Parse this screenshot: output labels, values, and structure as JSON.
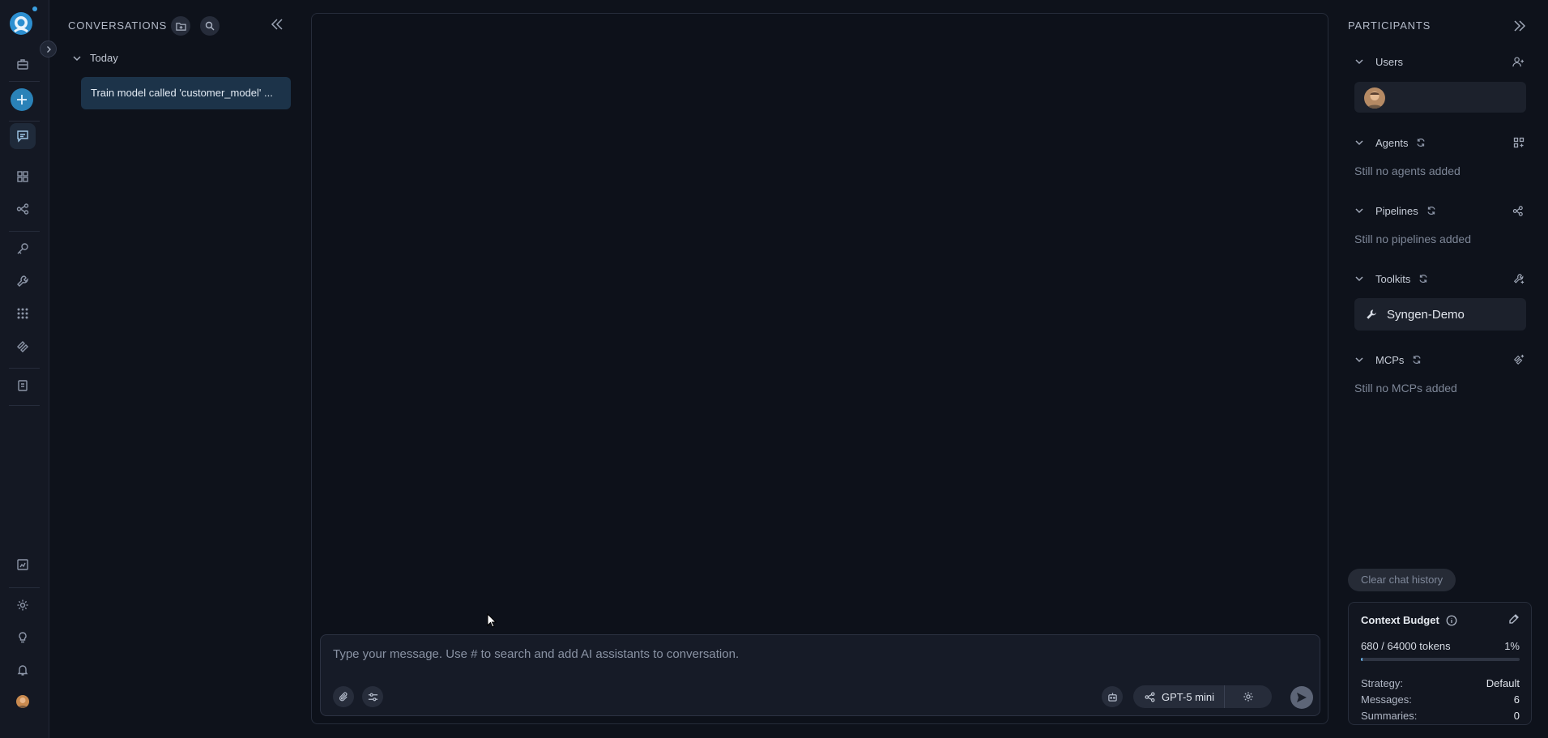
{
  "sidebar": {
    "items": [
      {
        "icon": "briefcase-icon"
      },
      {
        "icon": "plus-icon"
      },
      {
        "icon": "chat-icon",
        "active": true
      },
      {
        "icon": "grid-icon"
      },
      {
        "icon": "pipeline-icon"
      },
      {
        "icon": "key-icon"
      },
      {
        "icon": "wrench-icon"
      },
      {
        "icon": "apps-icon"
      },
      {
        "icon": "mcp-icon"
      },
      {
        "icon": "artifacts-icon"
      },
      {
        "icon": "reports-icon"
      },
      {
        "icon": "settings-icon"
      },
      {
        "icon": "lightbulb-icon"
      },
      {
        "icon": "bell-icon"
      },
      {
        "icon": "user-avatar"
      }
    ]
  },
  "conversations": {
    "title": "CONVERSATIONS",
    "group": "Today",
    "items": [
      "Train model called 'customer_model' ..."
    ]
  },
  "chat": {
    "input_placeholder": "Type your message. Use # to search and add AI assistants to conversation.",
    "model": "GPT-5 mini"
  },
  "participants": {
    "title": "PARTICIPANTS",
    "sections": {
      "users": {
        "label": "Users"
      },
      "agents": {
        "label": "Agents",
        "empty": "Still no agents added"
      },
      "pipelines": {
        "label": "Pipelines",
        "empty": "Still no pipelines added"
      },
      "toolkits": {
        "label": "Toolkits",
        "items": [
          "Syngen-Demo"
        ]
      },
      "mcps": {
        "label": "MCPs",
        "empty": "Still no MCPs added"
      }
    },
    "clear_label": "Clear chat history"
  },
  "budget": {
    "title": "Context Budget",
    "tokens": "680 / 64000 tokens",
    "percent": "1%",
    "fill": 0.0106,
    "strategy_label": "Strategy:",
    "strategy_value": "Default",
    "messages_label": "Messages:",
    "messages_value": "6",
    "summaries_label": "Summaries:",
    "summaries_value": "0"
  },
  "colors": {
    "accent": "#2a82b8",
    "selected_item": "#1c3349",
    "background": "#0e121b"
  }
}
